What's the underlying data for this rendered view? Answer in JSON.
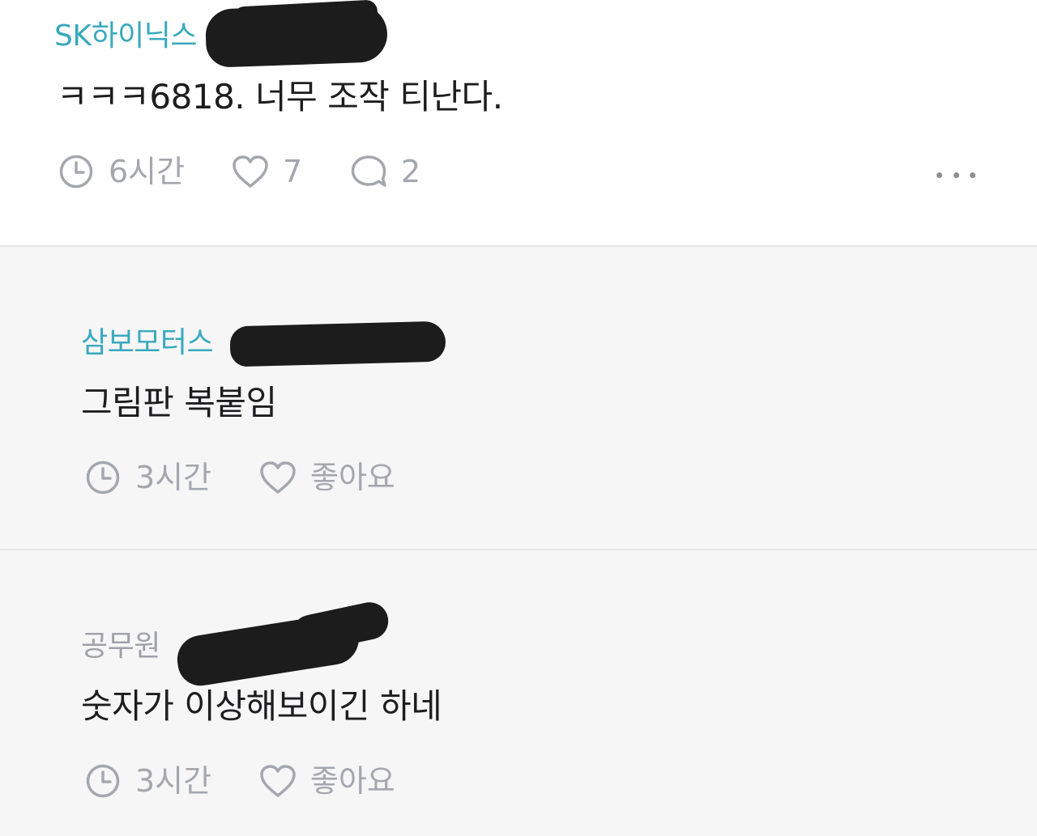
{
  "post": {
    "author": "SK하이닉스",
    "author_color": "#38a9bd",
    "body": "ㅋㅋㅋ6818. 너무 조작 티난다.",
    "time": "6시간",
    "likes": "7",
    "comments": "2",
    "more_icon": "ellipsis-icon"
  },
  "replies": [
    {
      "author": "삼보모터스",
      "author_color": "#38a9bd",
      "body": "그림판 복붙임",
      "time": "3시간",
      "like_label": "좋아요"
    },
    {
      "author": "공무원",
      "author_color": "#9ea1a7",
      "body": "숫자가 이상해보이긴 하네",
      "time": "3시간",
      "like_label": "좋아요"
    }
  ],
  "colors": {
    "meta_gray": "#a4a7ad",
    "reply_background": "#f6f6f7",
    "redaction": "#1c1c1c"
  },
  "icons": {
    "time": "clock-icon",
    "like": "heart-icon",
    "comment": "speech-bubble-icon"
  }
}
